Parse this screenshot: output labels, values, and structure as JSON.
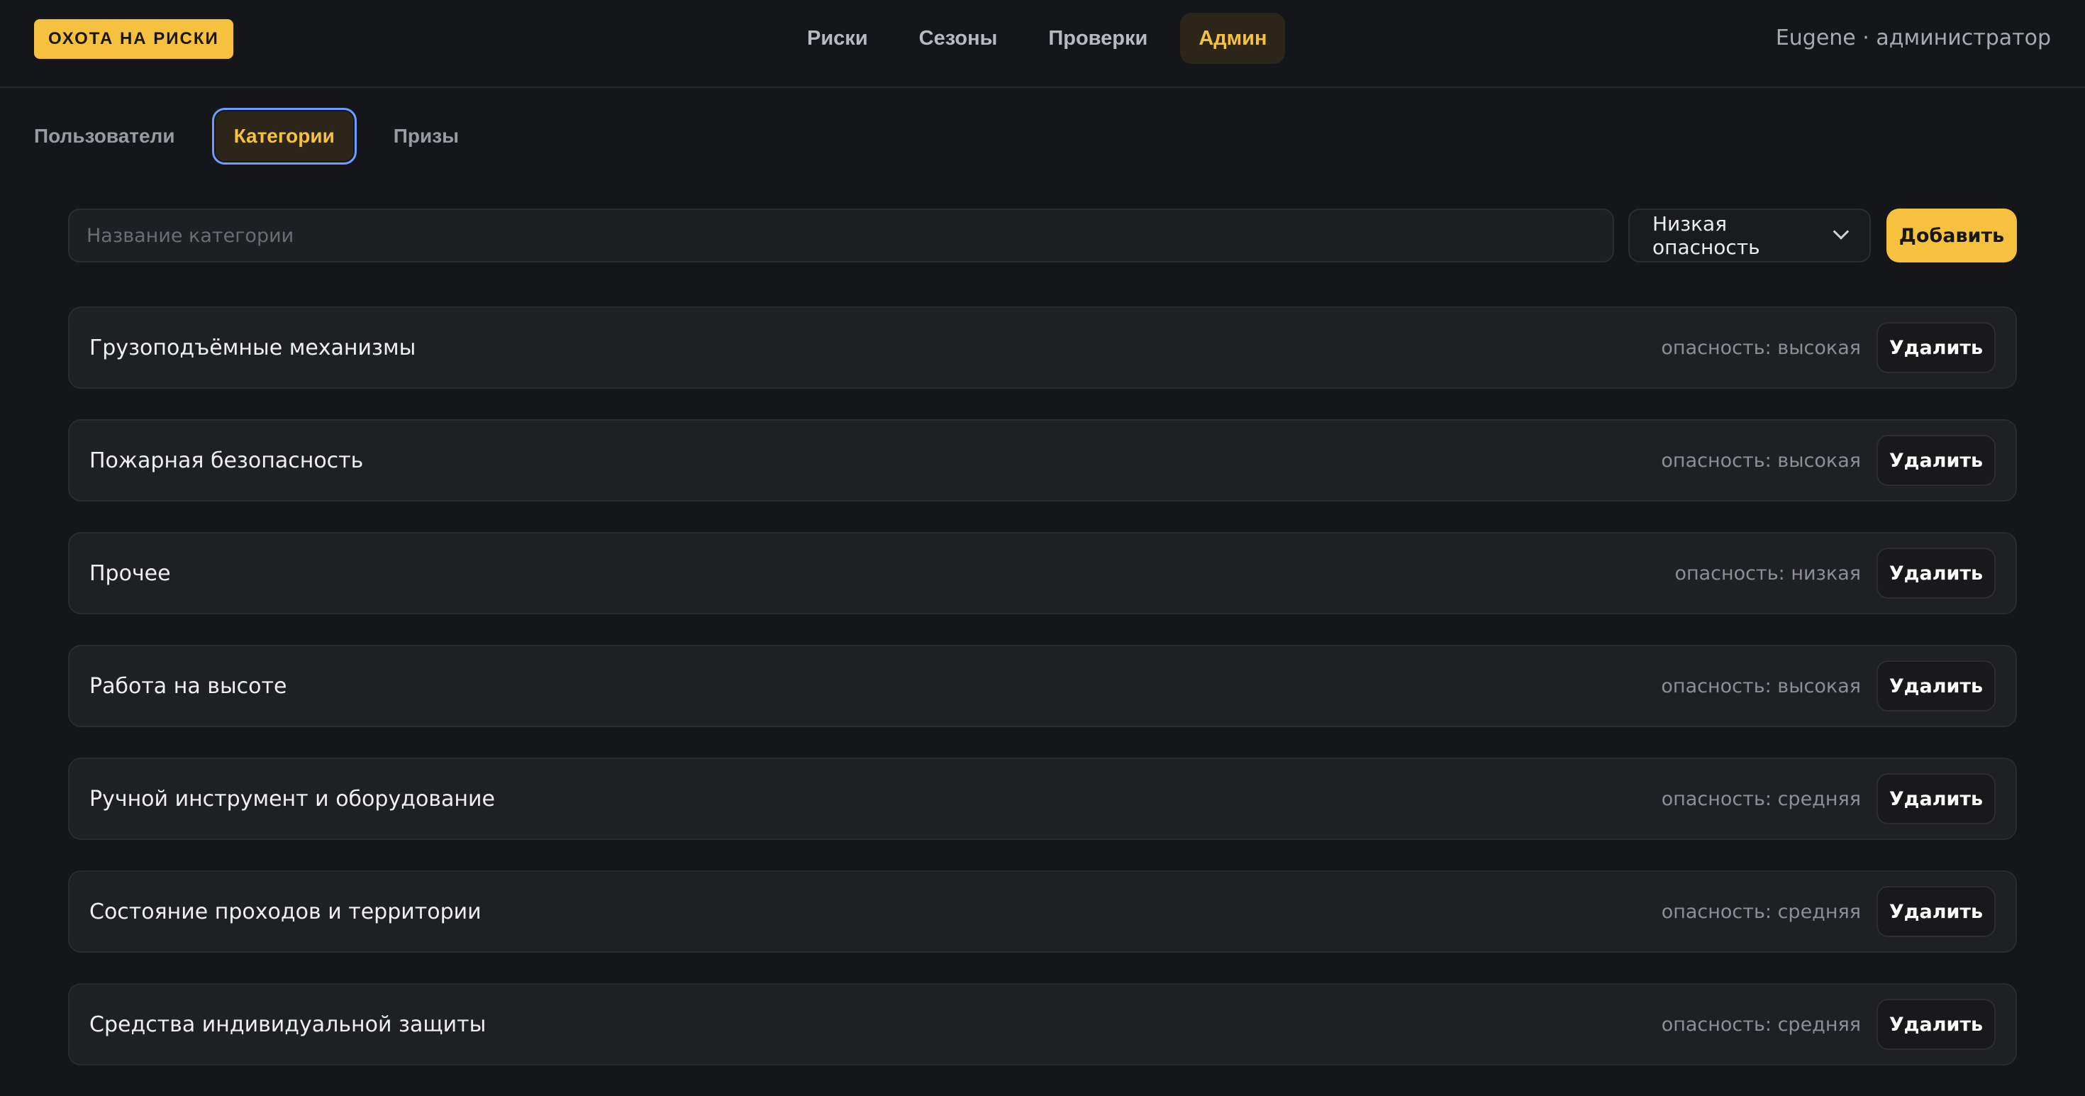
{
  "header": {
    "logo": "ОХОТА НА РИСКИ",
    "nav": [
      {
        "label": "Риски",
        "active": false
      },
      {
        "label": "Сезоны",
        "active": false
      },
      {
        "label": "Проверки",
        "active": false
      },
      {
        "label": "Админ",
        "active": true
      }
    ],
    "user": "Eugene · администратор"
  },
  "admin_tabs": [
    {
      "label": "Пользователи",
      "active": false
    },
    {
      "label": "Категории",
      "active": true
    },
    {
      "label": "Призы",
      "active": false
    }
  ],
  "add_form": {
    "name_placeholder": "Название категории",
    "name_value": "",
    "danger_selected": "Низкая опасность",
    "add_label": "Добавить"
  },
  "categories": [
    {
      "name": "Грузоподъёмные механизмы",
      "danger": "опасность: высокая",
      "delete_label": "Удалить"
    },
    {
      "name": "Пожарная безопасность",
      "danger": "опасность: высокая",
      "delete_label": "Удалить"
    },
    {
      "name": "Прочее",
      "danger": "опасность: низкая",
      "delete_label": "Удалить"
    },
    {
      "name": "Работа на высоте",
      "danger": "опасность: высокая",
      "delete_label": "Удалить"
    },
    {
      "name": "Ручной инструмент и оборудование",
      "danger": "опасность: средняя",
      "delete_label": "Удалить"
    },
    {
      "name": "Состояние проходов и территории",
      "danger": "опасность: средняя",
      "delete_label": "Удалить"
    },
    {
      "name": "Средства индивидуальной защиты",
      "danger": "опасность: средняя",
      "delete_label": "Удалить"
    }
  ],
  "colors": {
    "accent": "#f5c13f",
    "background": "#151619",
    "card": "#1f2024",
    "focus_ring": "#6f9dff"
  }
}
